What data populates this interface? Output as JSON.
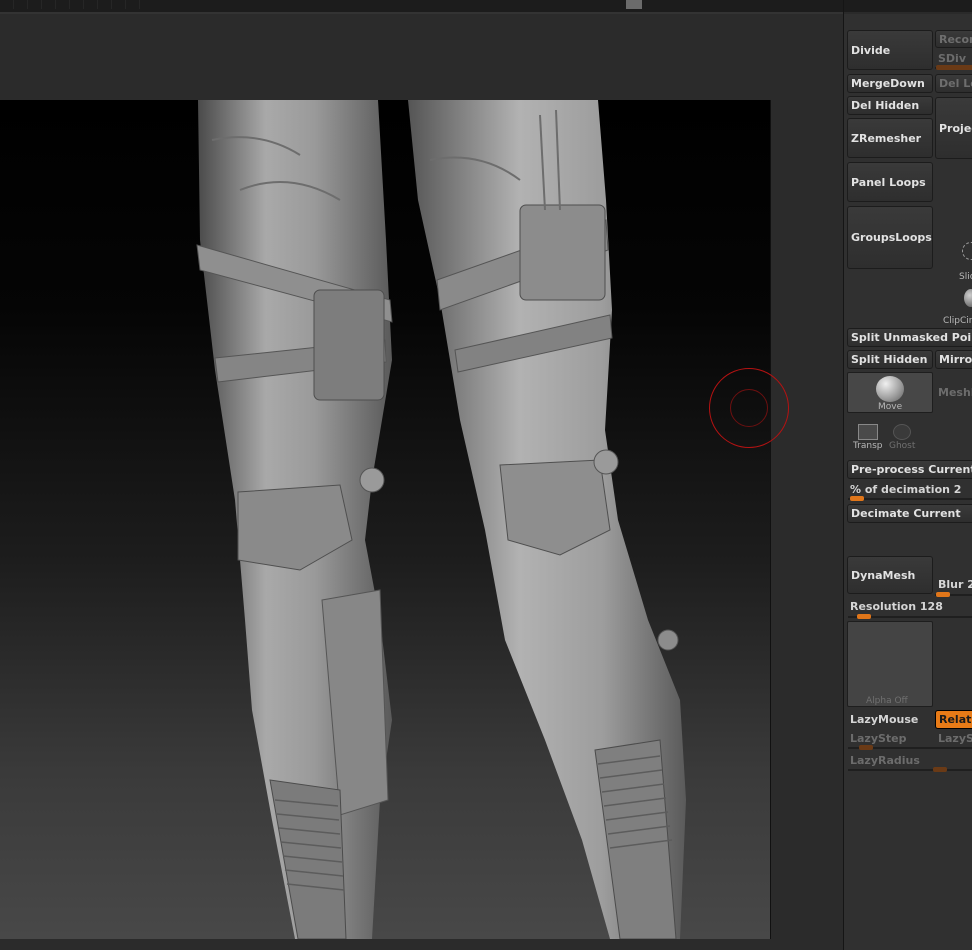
{
  "colors": {
    "accent": "#e87b17",
    "brush_cursor": "#b51212",
    "panel_bg": "#303030",
    "viewport_top": "#000000",
    "viewport_bottom": "#484848"
  },
  "icons": {
    "brush_cursor": "brush-circle-icon",
    "slice": "slice-curve-icon",
    "clip": "clip-circle-icon",
    "move": "move-brush-sphere-icon",
    "transp": "transparency-icon",
    "ghost": "ghost-icon"
  },
  "panel": {
    "divide": "Divide",
    "reconstruct": "Recon",
    "sdiv": "SDiv",
    "merge_down": "MergeDown",
    "del_lower": "Del Lo",
    "del_hidden": "Del Hidden",
    "zremesher": "ZRemesher",
    "project": "Projec",
    "panel_loops": "Panel Loops",
    "groups_loops": "GroupsLoops",
    "slice_label": "Slic",
    "clip_label": "ClipCir",
    "split_unmasked": "Split Unmasked Point",
    "split_hidden": "Split Hidden",
    "mirror": "Mirror",
    "move_label": "Move",
    "meshi": "MeshI",
    "transp": "Transp",
    "ghost": "Ghost",
    "preprocess": "Pre-process Current",
    "decimation_label": "% of decimation 2",
    "decimate_current": "Decimate Current",
    "dynamesh": "DynaMesh",
    "blur": "Blur 2",
    "resolution": "Resolution 128",
    "alpha_off": "Alpha  Off",
    "lazymouse": "LazyMouse",
    "relative": "Relati",
    "lazystep": "LazyStep",
    "lazys": "LazyS",
    "lazyradius": "LazyRadius"
  },
  "slider_values": {
    "sdiv": 0.1,
    "decimation": 0.05,
    "blur": 0.1,
    "resolution": 0.05,
    "lazystep": 0.1,
    "lazyradius": 0.5
  }
}
